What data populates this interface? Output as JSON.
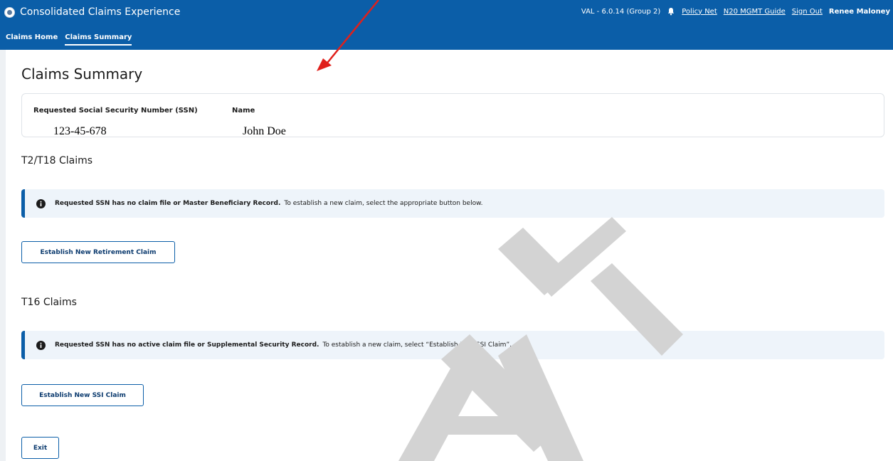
{
  "header": {
    "app_title": "Consolidated Claims Experience",
    "version": "VAL - 6.0.14 (Group 2)",
    "links": [
      "Policy Net",
      "N20 MGMT Guide",
      "Sign Out"
    ],
    "user": "Renee Maloney"
  },
  "nav": {
    "tabs": [
      "Claims Home",
      "Claims Summary"
    ],
    "active": "Claims Summary"
  },
  "page": {
    "title": "Claims Summary"
  },
  "person": {
    "ssn_label": "Requested Social Security Number (SSN)",
    "ssn_value": "123-45-678",
    "name_label": "Name",
    "name_value": "John Doe"
  },
  "t2t18": {
    "heading": "T2/T18 Claims",
    "alert_bold": "Requested SSN has no claim file or Master Beneficiary Record.",
    "alert_text": "To establish a new claim, select the appropriate button below.",
    "button": "Establish New Retirement Claim"
  },
  "t16": {
    "heading": "T16 Claims",
    "alert_bold": "Requested SSN has no active claim file or Supplemental Security Record.",
    "alert_text": "To establish a new claim, select “Establish New SSI Claim”.",
    "button": "Establish New SSI Claim"
  },
  "exit_button": "Exit",
  "watermark_text": "DRAFT",
  "colors": {
    "brand": "#0b5ea8",
    "alert_bg": "#eef4fa",
    "arrow": "#e0201b",
    "watermark": "#d0d0d0"
  },
  "icons": [
    "logo-icon",
    "bell-icon",
    "info-icon",
    "annotation-arrow"
  ]
}
